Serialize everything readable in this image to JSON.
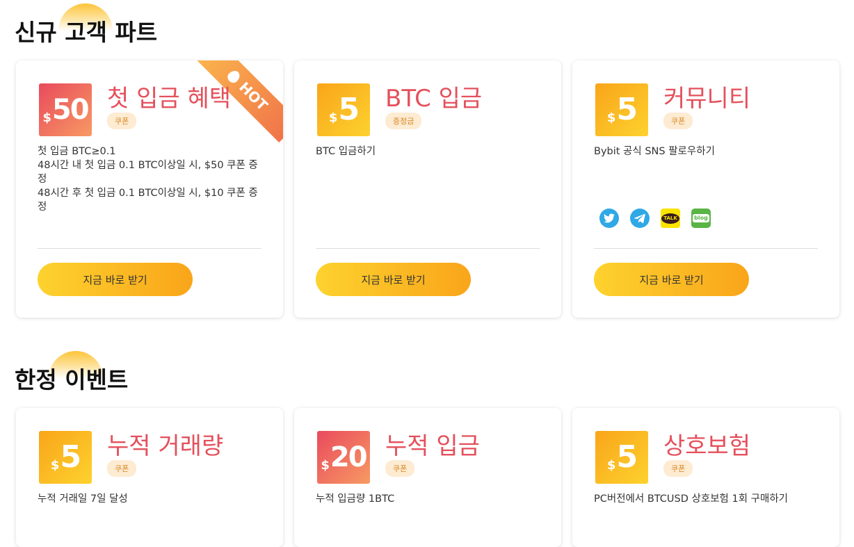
{
  "sections": [
    {
      "title": "신규 고객 파트",
      "cards": [
        {
          "badge": {
            "currency": "$",
            "amount": "50",
            "style": "red"
          },
          "title": "첫 입금 혜택",
          "tag": "쿠폰",
          "hot": "HOT",
          "desc": [
            "첫 입금 BTC≥0.1",
            "48시간 내 첫 입금 0.1 BTC이상일 시, $50 쿠폰 증정",
            "48시간 후 첫 입금 0.1 BTC이상일 시, $10 쿠폰 증정"
          ],
          "cta": "지금 바로 받기"
        },
        {
          "badge": {
            "currency": "$",
            "amount": "5",
            "style": "gold"
          },
          "title": "BTC 입금",
          "tag": "증정금",
          "desc": [
            "BTC 입금하기"
          ],
          "cta": "지금 바로 받기"
        },
        {
          "badge": {
            "currency": "$",
            "amount": "5",
            "style": "gold"
          },
          "title": "커뮤니티",
          "tag": "쿠폰",
          "desc": [
            "Bybit 공식 SNS 팔로우하기"
          ],
          "socials": [
            {
              "icon": "twitter-icon",
              "color": "#2fa8e6"
            },
            {
              "icon": "telegram-icon",
              "color": "#2fa8e6"
            },
            {
              "icon": "kakaotalk-icon",
              "color": "#fbe300",
              "text": "TALK"
            },
            {
              "icon": "blog-icon",
              "color": "#5ab446",
              "text": "blog"
            }
          ],
          "cta": "지금 바로 받기"
        }
      ]
    },
    {
      "title": "한정 이벤트",
      "cards": [
        {
          "badge": {
            "currency": "$",
            "amount": "5",
            "style": "gold"
          },
          "title": "누적 거래량",
          "tag": "쿠폰",
          "desc": [
            "누적 거래일 7일 달성"
          ]
        },
        {
          "badge": {
            "currency": "$",
            "amount": "20",
            "style": "red"
          },
          "title": "누적 입금",
          "tag": "쿠폰",
          "desc": [
            "누적 입금량 1BTC"
          ]
        },
        {
          "badge": {
            "currency": "$",
            "amount": "5",
            "style": "gold"
          },
          "title": "상호보험",
          "tag": "쿠폰",
          "desc": [
            "PC버전에서 BTCUSD 상호보험 1회 구매하기"
          ]
        }
      ]
    }
  ]
}
